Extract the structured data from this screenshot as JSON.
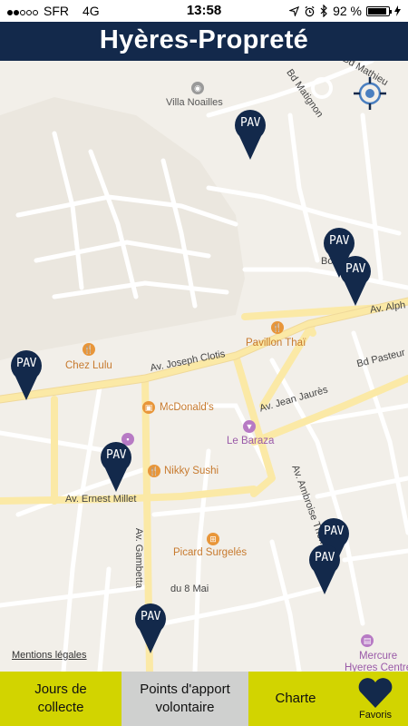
{
  "status_bar": {
    "carrier": "SFR",
    "network": "4G",
    "time": "13:58",
    "battery": "92 %",
    "battery_level": 0.92,
    "signal_bars_filled": 2,
    "signal_bars_total": 5
  },
  "header": {
    "title": "Hyères-Propreté"
  },
  "map": {
    "places": {
      "villa": "Villa Noailles",
      "pavillon": "Pavillon Thaï",
      "chez_lulu": "Chez Lulu",
      "mcdonalds": "McDonald's",
      "le_baraza": "Le Baraza",
      "nikky": "Nikky Sushi",
      "picard": "Picard Surgelés",
      "mercure": "Mercure\nHyeres Centre"
    },
    "streets": {
      "bd_matignon": "Bd Matignon",
      "bd_mathieu": "Bd Mathieu",
      "bo": "Bo",
      "av_alph": "Av. Alph",
      "clotis": "Av. Joseph Clotis",
      "pasteur": "Bd Pasteur",
      "jaures": "Av. Jean Jaurès",
      "millet": "Av. Ernest Millet",
      "gambetta": "Av. Gambetta",
      "ambroise": "Av. Ambroise Thomas",
      "du8mai": "du 8 Mai"
    },
    "pin_label": "PAV",
    "pin_color": "#13294b",
    "mentions": "Mentions légales"
  },
  "tabs": {
    "jours": "Jours de\ncollecte",
    "points": "Points d'apport\nvolontaire",
    "charte": "Charte",
    "favoris": "Favoris"
  },
  "colors": {
    "header": "#13294b",
    "tab_active": "#cfd0cf",
    "tab_bg": "#d2d400",
    "road_main": "#fbe9a6"
  },
  "icons": {
    "locate": "crosshair-locate-icon",
    "favoris": "heart-icon",
    "bluetooth": "bluetooth-icon",
    "alarm": "alarm-icon",
    "location": "location-arrow-icon"
  }
}
